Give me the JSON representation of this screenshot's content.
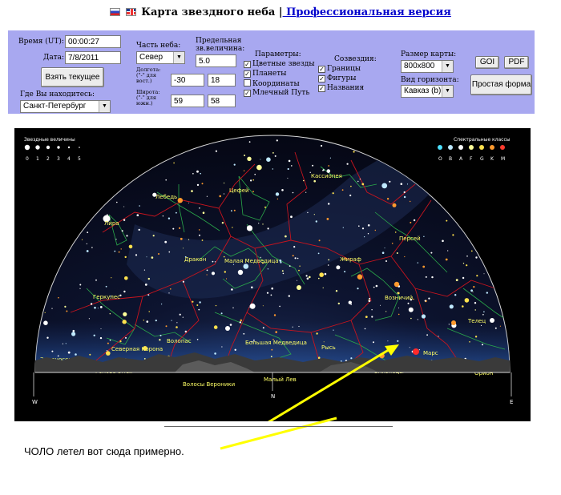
{
  "header": {
    "title": "Карта звездного неба |",
    "pro_link": " Профессиональная версия"
  },
  "panel": {
    "time_label": "Время (UT):",
    "time_value": "00:00:27",
    "date_label": "Дата:",
    "date_value": "7/8/2011",
    "take_current_button": "Взять текущее",
    "location_label": "Где Вы находитесь:",
    "location_value": "Санкт-Петербург",
    "sky_part_label": "Часть неба:",
    "sky_part_value": "Север",
    "longitude_label": "Долгота:",
    "longitude_hint": "(\"-\" для вост.)",
    "longitude_deg": "-30",
    "longitude_min": "18",
    "latitude_label": "Широта:",
    "latitude_hint": "(\"-\" для южн.)",
    "latitude_deg": "59",
    "latitude_min": "58",
    "limit_mag_label": "Предельная зв.величина:",
    "limit_mag_value": "5.0",
    "params_label": "Параметры:",
    "params": [
      {
        "label": "Цветные звезды",
        "checked": true
      },
      {
        "label": "Планеты",
        "checked": true
      },
      {
        "label": "Координаты",
        "checked": false
      },
      {
        "label": "Млечный Путь",
        "checked": true
      }
    ],
    "constellations_label": "Созвездия:",
    "constellations": [
      {
        "label": "Границы",
        "checked": true
      },
      {
        "label": "Фигуры",
        "checked": true
      },
      {
        "label": "Названия",
        "checked": true
      }
    ],
    "map_size_label": "Размер карты:",
    "map_size_value": "800x800",
    "horizon_label": "Вид горизонта:",
    "horizon_value": "Кавказ (b)",
    "goi_button": "GOI",
    "pdf_button": "PDF",
    "simple_form_button": "Простая форма"
  },
  "map": {
    "magnitudes_title": "Звездные величины",
    "magnitudes": [
      "0",
      "1",
      "2",
      "3",
      "4",
      "5"
    ],
    "spectral_title": "Спектральные классы",
    "spectral_classes": [
      "O",
      "B",
      "A",
      "F",
      "G",
      "K",
      "M"
    ],
    "spectral_colors": [
      "#4de0ff",
      "#bfe9ff",
      "#ffffff",
      "#ffff99",
      "#ffe14d",
      "#ff9a2e",
      "#ff3b2e"
    ],
    "constellations": [
      "Кассиопея",
      "Цефей",
      "Лебедь",
      "Лира",
      "Персей",
      "Дракон",
      "Малая Медведица",
      "Жираф",
      "Геркулес",
      "Возничий",
      "Телец",
      "Волопас",
      "Северная Корона",
      "Змееносец",
      "Голова Змеи",
      "Гончие Псы",
      "Большая Медведица",
      "Рысь",
      "Марс",
      "Близнецы",
      "Малый Лев",
      "Волосы Вероники",
      "Орион"
    ],
    "compass_west": "W",
    "compass_north": "N",
    "compass_east": "E",
    "line_color": "#c8141e",
    "figure_color": "#2aa84a"
  },
  "annotation": {
    "caption": "ЧОЛО летел вот сюда примерно.",
    "arrow_color": "#ffff00"
  }
}
